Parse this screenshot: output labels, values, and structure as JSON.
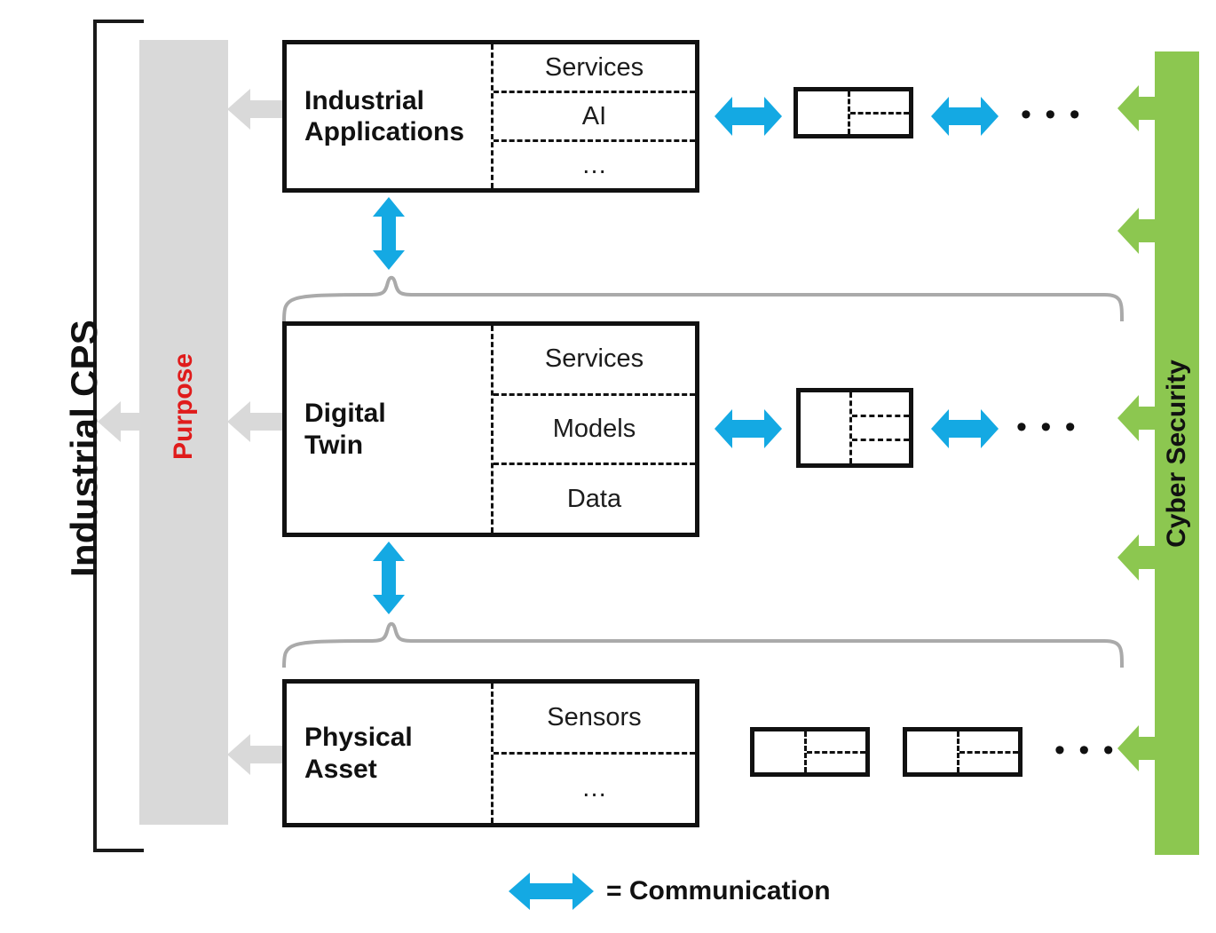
{
  "diagram": {
    "title": "Industrial CPS",
    "purpose_label": "Purpose",
    "cyber_label": "Cyber Security",
    "ellipsis": "• • •",
    "dots_inline": "…"
  },
  "layers": [
    {
      "id": "industrial-applications",
      "name": "Industrial\nApplications",
      "name_line1": "Industrial",
      "name_line2": "Applications",
      "subitems": [
        "Services",
        "AI",
        "…"
      ],
      "module_rows": 2,
      "module_count": 1,
      "has_arrows": true,
      "trailing_dots": "• • •"
    },
    {
      "id": "digital-twin",
      "name": "Digital\nTwin",
      "name_line1": "Digital",
      "name_line2": "Twin",
      "subitems": [
        "Services",
        "Models",
        "Data"
      ],
      "module_rows": 3,
      "module_count": 1,
      "has_arrows": true,
      "trailing_dots": "• • •"
    },
    {
      "id": "physical-asset",
      "name": "Physical\nAsset",
      "name_line1": "Physical",
      "name_line2": "Asset",
      "subitems": [
        "Sensors",
        "…"
      ],
      "module_rows": 2,
      "module_count": 2,
      "has_arrows": false,
      "trailing_dots": "• • •"
    }
  ],
  "legend": {
    "symbol_name": "blue-double-arrow",
    "text": "= Communication"
  },
  "colors": {
    "communication_arrow": "#14a9e3",
    "cyber_security": "#8cc750",
    "purpose_bar": "#d9d9d9",
    "purpose_text": "#e01b1b",
    "outline": "#111111",
    "brace": "#aaaaaa"
  }
}
